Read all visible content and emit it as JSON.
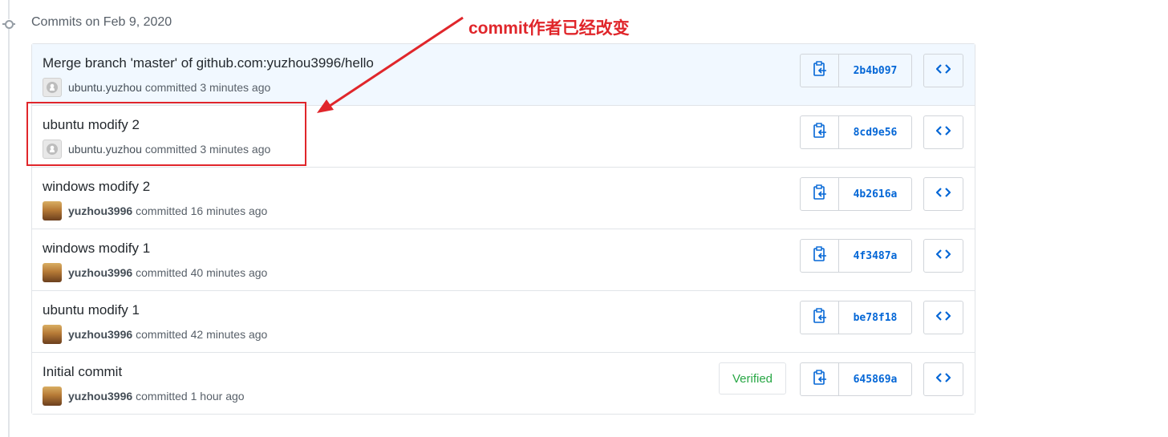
{
  "group_title": "Commits on Feb 9, 2020",
  "commits": [
    {
      "title": "Merge branch 'master' of github.com:yuzhou3996/hello",
      "author": "ubuntu.yuzhou",
      "time": "committed 3 minutes ago",
      "sha": "2b4b097",
      "avatar": "github-default-icon"
    },
    {
      "title": "ubuntu modify 2",
      "author": "ubuntu.yuzhou",
      "time": "committed 3 minutes ago",
      "sha": "8cd9e56",
      "avatar": "github-default-icon"
    },
    {
      "title": "windows modify 2",
      "author": "yuzhou3996",
      "time": "committed 16 minutes ago",
      "sha": "4b2616a",
      "avatar": "user-photo"
    },
    {
      "title": "windows modify 1",
      "author": "yuzhou3996",
      "time": "committed 40 minutes ago",
      "sha": "4f3487a",
      "avatar": "user-photo"
    },
    {
      "title": "ubuntu modify 1",
      "author": "yuzhou3996",
      "time": "committed 42 minutes ago",
      "sha": "be78f18",
      "avatar": "user-photo"
    },
    {
      "title": "Initial commit",
      "author": "yuzhou3996",
      "time": "committed 1 hour ago",
      "sha": "645869a",
      "avatar": "user-photo",
      "badge": "Verified"
    }
  ],
  "annotation": {
    "text": "commit作者已经改变",
    "color": "#e0262b"
  },
  "colors": {
    "link": "#0366d6",
    "verified": "#28a745",
    "highlight_row": "#f1f8ff"
  }
}
